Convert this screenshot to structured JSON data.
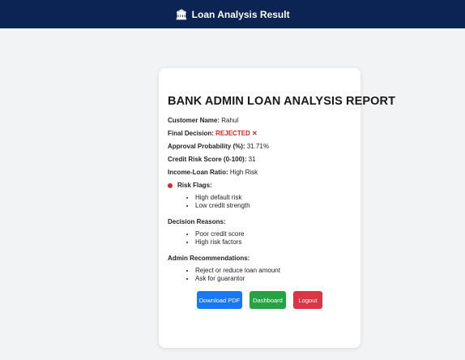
{
  "header": {
    "icon": "bank-icon",
    "icon_glyph": "🏛",
    "title": "Loan Analysis Result",
    "bg_color": "#0b2454"
  },
  "report": {
    "title": "BANK ADMIN LOAN ANALYSIS REPORT",
    "customer_name_label": "Customer Name:",
    "customer_name": "Rahul",
    "final_decision_label": "Final Decision:",
    "final_decision": "REJECTED ✕",
    "final_decision_color": "#e02424",
    "approval_probability_label": "Approval Probability (%):",
    "approval_probability": "31.71%",
    "credit_risk_label": "Credit Risk Score (0-100):",
    "credit_risk": "31",
    "income_loan_ratio_label": "Income-Loan Ratio:",
    "income_loan_ratio": "High Risk",
    "risk_flags": {
      "title": "Risk Flags:",
      "icon": "red-circle-icon",
      "icon_color": "#e02424",
      "items": [
        "High default risk",
        "Low credit strength"
      ]
    },
    "decision_reasons": {
      "title": "Decision Reasons:",
      "items": [
        "Poor credit score",
        "High risk factors"
      ]
    },
    "admin_recommendations": {
      "title": "Admin Recommendations:",
      "items": [
        "Reject or reduce loan amount",
        "Ask for guarantor"
      ]
    }
  },
  "buttons": {
    "download_pdf": {
      "label": "Download PDF",
      "color": "#1877f2"
    },
    "dashboard": {
      "label": "Dashboard",
      "color": "#27a243"
    },
    "logout": {
      "label": "Logout",
      "color": "#dc3545"
    }
  }
}
